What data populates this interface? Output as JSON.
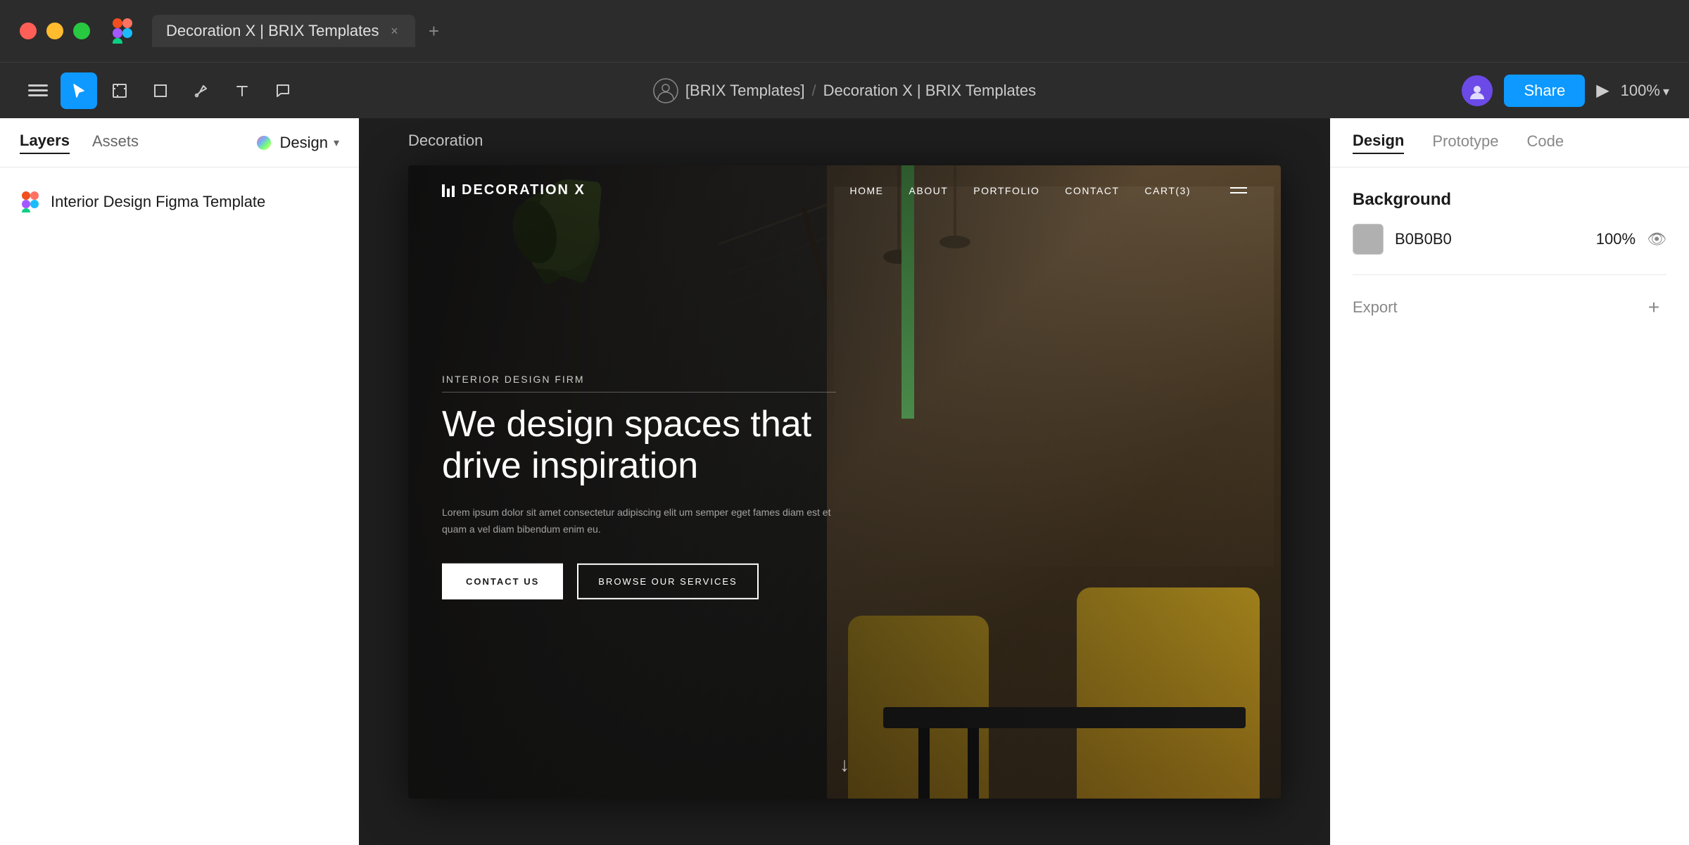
{
  "window": {
    "tab_title": "Decoration X | BRIX Templates",
    "close_label": "×",
    "add_tab_label": "+"
  },
  "toolbar": {
    "breadcrumb_org": "[BRIX Templates]",
    "breadcrumb_sep": "/",
    "breadcrumb_file": "Decoration X | BRIX Templates",
    "share_label": "Share",
    "zoom_label": "100%"
  },
  "sidebar_left": {
    "layers_tab": "Layers",
    "assets_tab": "Assets",
    "design_tab": "Design",
    "layer_item": "Interior Design Figma Template"
  },
  "canvas": {
    "frame_label": "Decoration",
    "site": {
      "logo": "DECORATION X",
      "nav_links": [
        "HOME",
        "ABOUT",
        "PORTFOLIO",
        "CONTACT",
        "CART(3)"
      ],
      "subtitle": "INTERIOR DESIGN FIRM",
      "headline_line1": "We design spaces that",
      "headline_line2": "drive inspiration",
      "description": "Lorem ipsum dolor sit amet consectetur adipiscing elit um semper eget fames diam est et quam a vel diam bibendum enim eu.",
      "btn_contact": "CONTACT US",
      "btn_browse": "BROWSE OUR SERVICES"
    }
  },
  "sidebar_right": {
    "design_tab": "Design",
    "prototype_tab": "Prototype",
    "code_tab": "Code",
    "background_label": "Background",
    "color_value": "B0B0B0",
    "opacity_value": "100%",
    "export_label": "Export",
    "export_add_label": "+"
  }
}
